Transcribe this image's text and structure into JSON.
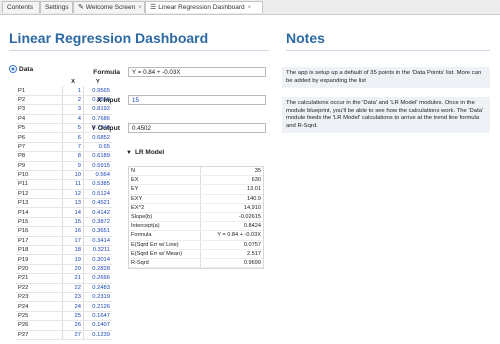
{
  "tabs": [
    {
      "label": "Contents"
    },
    {
      "label": "Settings"
    },
    {
      "label": "Welcome Screen",
      "close": "×"
    },
    {
      "label": "Linear Regression Dashboard",
      "close": "×"
    }
  ],
  "main": {
    "title": "Linear Regression Dashboard",
    "data_section": {
      "title": "Data",
      "col_x": "X",
      "col_y": "Y",
      "rows": [
        {
          "label": "P1",
          "x": "1",
          "y": "0.9565"
        },
        {
          "label": "P2",
          "x": "2",
          "y": "0.8828"
        },
        {
          "label": "P3",
          "x": "3",
          "y": "0.8192"
        },
        {
          "label": "P4",
          "x": "4",
          "y": "0.7686"
        },
        {
          "label": "P5",
          "x": "5",
          "y": "0.7248"
        },
        {
          "label": "P6",
          "x": "6",
          "y": "0.6852"
        },
        {
          "label": "P7",
          "x": "7",
          "y": "0.65"
        },
        {
          "label": "P8",
          "x": "8",
          "y": "0.6189"
        },
        {
          "label": "P9",
          "x": "9",
          "y": "0.5915"
        },
        {
          "label": "P10",
          "x": "10",
          "y": "0.564"
        },
        {
          "label": "P11",
          "x": "11",
          "y": "0.5385"
        },
        {
          "label": "P12",
          "x": "12",
          "y": "0.5124"
        },
        {
          "label": "P13",
          "x": "13",
          "y": "0.4521"
        },
        {
          "label": "P14",
          "x": "14",
          "y": "0.4142"
        },
        {
          "label": "P15",
          "x": "15",
          "y": "0.3872"
        },
        {
          "label": "P16",
          "x": "16",
          "y": "0.3651"
        },
        {
          "label": "P17",
          "x": "17",
          "y": "0.3414"
        },
        {
          "label": "P18",
          "x": "18",
          "y": "0.3211"
        },
        {
          "label": "P19",
          "x": "19",
          "y": "0.3014"
        },
        {
          "label": "P20",
          "x": "20",
          "y": "0.2828"
        },
        {
          "label": "P21",
          "x": "21",
          "y": "0.2666"
        },
        {
          "label": "P22",
          "x": "22",
          "y": "0.2483"
        },
        {
          "label": "P23",
          "x": "23",
          "y": "0.2319"
        },
        {
          "label": "P24",
          "x": "24",
          "y": "0.2126"
        },
        {
          "label": "P25",
          "x": "25",
          "y": "0.1647"
        },
        {
          "label": "P26",
          "x": "26",
          "y": "0.1407"
        },
        {
          "label": "P27",
          "x": "27",
          "y": "0.1239"
        }
      ]
    },
    "formula": {
      "label": "Formula",
      "value": "Y = 0.84 + -0.03X"
    },
    "x_input": {
      "label": "X Input",
      "value": "15"
    },
    "y_output": {
      "label": "Y Output",
      "value": "0.4502"
    },
    "lr_model": {
      "title": "LR Model",
      "rows": [
        {
          "label": "N",
          "value": "35"
        },
        {
          "label": "EX",
          "value": "630"
        },
        {
          "label": "EY",
          "value": "13.01"
        },
        {
          "label": "EXY",
          "value": "140.9"
        },
        {
          "label": "EX^2",
          "value": "14,910"
        },
        {
          "label": "Slope(b)",
          "value": "-0.02615"
        },
        {
          "label": "Intercept(a)",
          "value": "0.8424"
        },
        {
          "label": "Formula",
          "value": "Y = 0.84 + -0.03X"
        },
        {
          "label": "E(Sqrd Err w/ Line)",
          "value": "0.0757"
        },
        {
          "label": "E(Sqrd Err w/ Mean)",
          "value": "2.517"
        },
        {
          "label": "R-Sqrd",
          "value": "0.9699"
        }
      ]
    }
  },
  "notes": {
    "title": "Notes",
    "items": [
      {
        "text": "The app is setup up a default of 35 points in the 'Data Points' list. More can be added by expanding the list"
      },
      {
        "text": "The calculations occur in the 'Data' and 'LR Model' modules. Once in the module blueprint, you'll be able to see how the calculations work. The 'Data' module feeds the 'LR Model' calculations to arrive at the trend line formula and R-Sqrd."
      }
    ]
  },
  "colors": {
    "accent": "#2d6aa3",
    "value_blue": "#1a45b8",
    "note_bg": "#eef2f6"
  }
}
